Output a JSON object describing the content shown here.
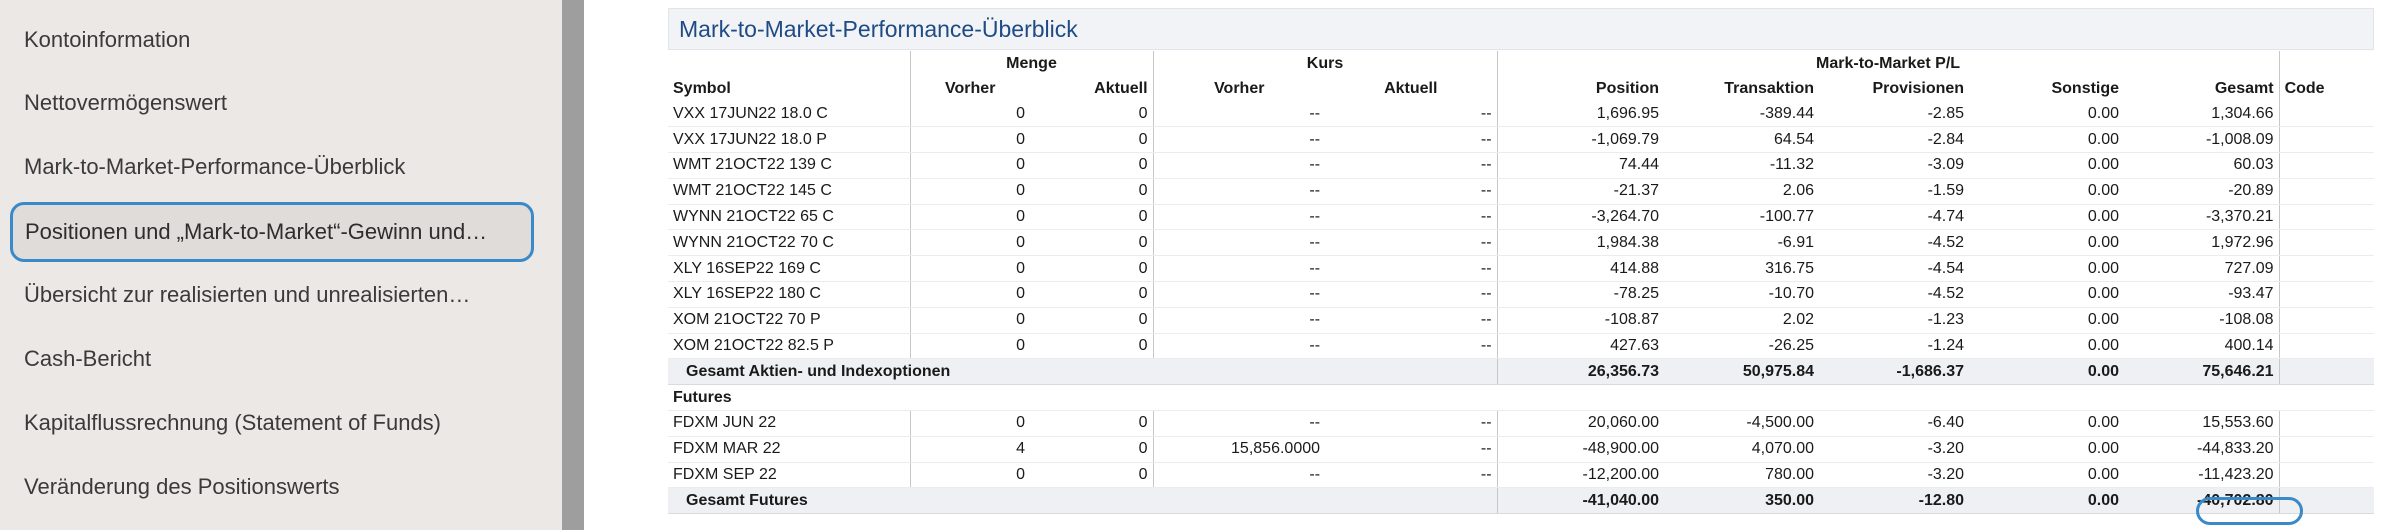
{
  "sidebar": {
    "items": [
      {
        "label": "Kontoinformation",
        "active": false
      },
      {
        "label": "Nettovermögenswert",
        "active": false
      },
      {
        "label": "Mark-to-Market-Performance-Überblick",
        "active": false
      },
      {
        "label": "Positionen und „Mark-to-Market“-Gewinn und…",
        "active": true
      },
      {
        "label": "Übersicht  zur realisierten und unrealisierten…",
        "active": false
      },
      {
        "label": "Cash-Bericht",
        "active": false
      },
      {
        "label": "Kapitalflussrechnung (Statement of Funds)",
        "active": false
      },
      {
        "label": "Veränderung des Positionswerts",
        "active": false
      }
    ]
  },
  "main": {
    "title": "Mark-to-Market-Performance-Überblick",
    "table": {
      "group_headers": {
        "menge": "Menge",
        "kurs": "Kurs",
        "mtm": "Mark-to-Market P/L"
      },
      "columns": [
        "Symbol",
        "Vorher",
        "Aktuell",
        "Vorher",
        "Aktuell",
        "Position",
        "Transaktion",
        "Provisionen",
        "Sonstige",
        "Gesamt",
        "Code"
      ],
      "options_rows": [
        [
          "VXX 17JUN22 18.0 C",
          "0",
          "0",
          "--",
          "--",
          "1,696.95",
          "-389.44",
          "-2.85",
          "0.00",
          "1,304.66"
        ],
        [
          "VXX 17JUN22 18.0 P",
          "0",
          "0",
          "--",
          "--",
          "-1,069.79",
          "64.54",
          "-2.84",
          "0.00",
          "-1,008.09"
        ],
        [
          "WMT 21OCT22 139 C",
          "0",
          "0",
          "--",
          "--",
          "74.44",
          "-11.32",
          "-3.09",
          "0.00",
          "60.03"
        ],
        [
          "WMT 21OCT22 145 C",
          "0",
          "0",
          "--",
          "--",
          "-21.37",
          "2.06",
          "-1.59",
          "0.00",
          "-20.89"
        ],
        [
          "WYNN 21OCT22 65 C",
          "0",
          "0",
          "--",
          "--",
          "-3,264.70",
          "-100.77",
          "-4.74",
          "0.00",
          "-3,370.21"
        ],
        [
          "WYNN 21OCT22 70 C",
          "0",
          "0",
          "--",
          "--",
          "1,984.38",
          "-6.91",
          "-4.52",
          "0.00",
          "1,972.96"
        ],
        [
          "XLY 16SEP22 169 C",
          "0",
          "0",
          "--",
          "--",
          "414.88",
          "316.75",
          "-4.54",
          "0.00",
          "727.09"
        ],
        [
          "XLY 16SEP22 180 C",
          "0",
          "0",
          "--",
          "--",
          "-78.25",
          "-10.70",
          "-4.52",
          "0.00",
          "-93.47"
        ],
        [
          "XOM 21OCT22 70 P",
          "0",
          "0",
          "--",
          "--",
          "-108.87",
          "2.02",
          "-1.23",
          "0.00",
          "-108.08"
        ],
        [
          "XOM 21OCT22 82.5 P",
          "0",
          "0",
          "--",
          "--",
          "427.63",
          "-26.25",
          "-1.24",
          "0.00",
          "400.14"
        ]
      ],
      "options_total": [
        "Gesamt Aktien- und Indexoptionen",
        "26,356.73",
        "50,975.84",
        "-1,686.37",
        "0.00",
        "75,646.21"
      ],
      "futures_label": "Futures",
      "futures_rows": [
        [
          "FDXM JUN 22",
          "0",
          "0",
          "--",
          "--",
          "20,060.00",
          "-4,500.00",
          "-6.40",
          "0.00",
          "15,553.60"
        ],
        [
          "FDXM MAR 22",
          "4",
          "0",
          "15,856.0000",
          "--",
          "-48,900.00",
          "4,070.00",
          "-3.20",
          "0.00",
          "-44,833.20"
        ],
        [
          "FDXM SEP 22",
          "0",
          "0",
          "--",
          "--",
          "-12,200.00",
          "780.00",
          "-3.20",
          "0.00",
          "-11,423.20"
        ]
      ],
      "futures_total": [
        "Gesamt Futures",
        "-41,040.00",
        "350.00",
        "-12.80",
        "0.00",
        "-40,702.80"
      ]
    }
  }
}
